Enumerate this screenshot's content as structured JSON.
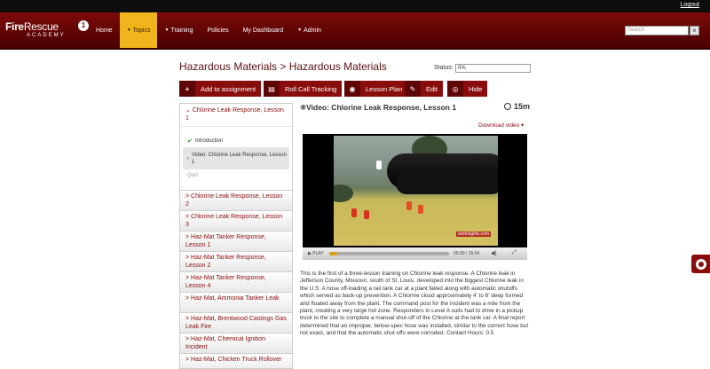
{
  "header": {
    "logout": "Logout",
    "logo": {
      "brand_bold": "Fire",
      "brand_thin": "Rescue",
      "badge": "1",
      "subtitle": "ACADEMY"
    },
    "nav": [
      {
        "label": "Home",
        "caret": false,
        "active": false
      },
      {
        "label": "Topics",
        "caret": true,
        "active": true
      },
      {
        "label": "Training",
        "caret": true,
        "active": false
      },
      {
        "label": "Policies",
        "caret": false,
        "active": false
      },
      {
        "label": "My Dashboard",
        "caret": false,
        "active": false
      },
      {
        "label": "Admin",
        "caret": true,
        "active": false
      }
    ],
    "search_placeholder": "Search"
  },
  "page": {
    "title": "Hazardous Materials > Hazardous Materials",
    "status_label": "Status:",
    "status_value": "0%"
  },
  "actions": [
    {
      "icon": "+",
      "label": "Add to assignment",
      "icon_name": "plus-icon"
    },
    {
      "icon": "▤",
      "label": "Roll Call Tracking",
      "icon_name": "list-icon"
    },
    {
      "icon": "◉",
      "label": "Lesson Plan",
      "icon_name": "target-icon"
    },
    {
      "icon": "✎",
      "label": "Edit",
      "icon_name": "edit-icon"
    },
    {
      "icon": "◎",
      "label": "Hide",
      "icon_name": "eye-icon"
    }
  ],
  "sidebar": {
    "current": {
      "title": "Chlorine Leak Response, Lesson 1",
      "subitems": [
        {
          "label": "Introduction",
          "state": "complete"
        },
        {
          "label": "Video: Chlorine Leak Response, Lesson 1",
          "state": "active"
        },
        {
          "label": "Quiz",
          "state": "muted"
        }
      ]
    },
    "items": [
      "Chlorine Leak Response, Lesson 2",
      "Chlorine Leak Response, Lesson 3",
      "Haz-Mat Tanker Response, Lesson 1",
      "Haz-Mat Tanker Response, Lesson 2",
      "Haz-Mat Tanker Response, Lesson 4",
      "Haz-Mat, Ammonia Tanker Leak",
      "Haz-Mat, Brentwood Castings Gas Leak Fire",
      "Haz-Mat, Chemical Ignition Incident",
      "Haz-Mat, Chicken Truck Rollover"
    ]
  },
  "main": {
    "video_title": "Video: Chlorine Leak Response, Lesson 1",
    "duration": "15m",
    "download": "Download video ▾",
    "player": {
      "watermark": "workingfire.com",
      "play_label": "PLAY",
      "time_current": "00:00",
      "time_total": "15:04",
      "progress": 0.07
    },
    "description": "This is the first of a three-lesson training on Chlorine leak response. A Chlorine leak in Jefferson County, Missouri, south of St. Louis, developed into the biggest Chlorine leak in the U.S. A hose off-loading a rail tank car at a plant failed along with automatic shutoffs which served as back-up prevention. A Chlorine cloud approximately 4' to 6' deep formed and floated away from the plant. The command post for the incident was a mile from the plant, creating a very large hot zone. Responders in Level A suits had to drive in a pickup truck to the site to complete a manual shut-off of the Chlorine at the tank car. A final report determined that an improper, below-spec hose was installed, similar to the correct hose but not exact, and that the automatic shut-offs were corroded. Contact Hours: 0.5"
  }
}
